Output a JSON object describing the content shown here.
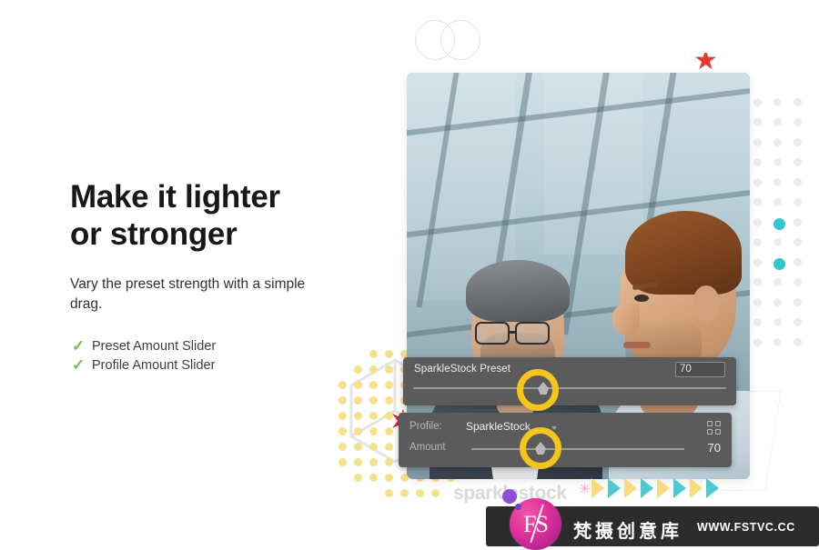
{
  "headline": {
    "line1": "Make it lighter",
    "line2": "or stronger"
  },
  "body": {
    "text": "Vary the preset strength with a simple drag."
  },
  "checklist": {
    "mark": "✓",
    "items": [
      {
        "label": "Preset Amount Slider"
      },
      {
        "label": "Profile Amount Slider"
      }
    ]
  },
  "preset_panel": {
    "title": "SparkleStock Preset",
    "value": "70"
  },
  "profile_panel": {
    "profile_label": "Profile:",
    "profile_value": "SparkleStock",
    "amount_label": "Amount",
    "amount_value": "70"
  },
  "branding": {
    "wordmark": "sparklestock",
    "asterisk": "✳"
  },
  "watermark": {
    "monogram": "FS",
    "name_cn": "梵摄创意库",
    "url": "WWW.FSTVC.CC"
  },
  "colors": {
    "background": "#ffffff",
    "headline": "#16181a",
    "check_green": "#6fbf4b",
    "panel_grey": "#5b5b5b",
    "highlight_ring": "#f6c51d",
    "accent_cyan": "#34c6ce",
    "accent_yellow": "#f7e08a",
    "accent_red": "#e03a33",
    "watermark_bar": "#2c2c2c",
    "watermark_pink": "#e0309a"
  },
  "decor": {
    "star_top": "★",
    "burst": "✹"
  }
}
